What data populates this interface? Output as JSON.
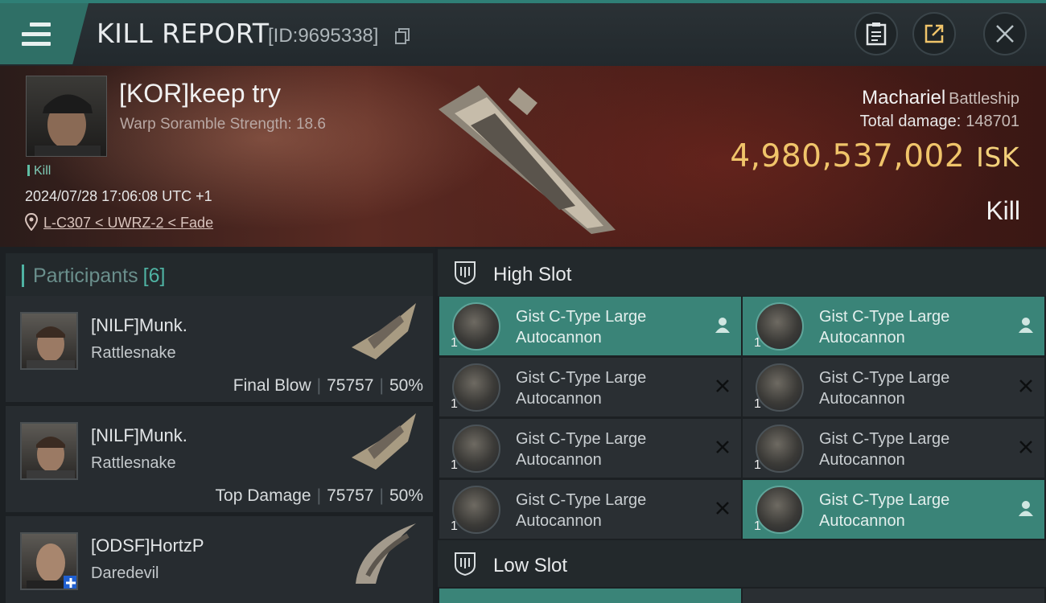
{
  "window": {
    "title": "KILL REPORT",
    "report_id": "[ID:9695338]"
  },
  "victim": {
    "name": "[KOR]keep try",
    "scramble": "Warp Soramble Strength: 18.6",
    "tag": "Kill",
    "datetime": "2024/07/28 17:06:08 UTC +1",
    "location": "L-C307 < UWRZ-2 < Fade",
    "ship_name": "Machariel",
    "ship_class": "Battleship",
    "total_damage_label": "Total damage:",
    "total_damage": "148701",
    "isk_value": "4,980,537,002",
    "isk_unit": "ISK",
    "kill_type": "Kill"
  },
  "participants": {
    "label": "Participants",
    "count": "[6]",
    "rows": [
      {
        "name": "[NILF]Munk.",
        "ship": "Rattlesnake",
        "role": "Final Blow",
        "damage": "75757",
        "percent": "50%"
      },
      {
        "name": "[NILF]Munk.",
        "ship": "Rattlesnake",
        "role": "Top Damage",
        "damage": "75757",
        "percent": "50%"
      },
      {
        "name": "[ODSF]HortzP",
        "ship": "Daredevil"
      }
    ]
  },
  "slots": {
    "high_label": "High Slot",
    "low_label": "Low Slot",
    "modules": [
      {
        "line1": "Gist C-Type Large",
        "line2": "Autocannon",
        "qty": "1",
        "status": "pilot-icon"
      },
      {
        "line1": "Gist C-Type Large",
        "line2": "Autocannon",
        "qty": "1",
        "status": "pilot-icon"
      },
      {
        "line1": "Gist C-Type Large",
        "line2": "Autocannon",
        "qty": "1",
        "status": "destroyed-icon"
      },
      {
        "line1": "Gist C-Type Large",
        "line2": "Autocannon",
        "qty": "1",
        "status": "destroyed-icon"
      },
      {
        "line1": "Gist C-Type Large",
        "line2": "Autocannon",
        "qty": "1",
        "status": "destroyed-icon"
      },
      {
        "line1": "Gist C-Type Large",
        "line2": "Autocannon",
        "qty": "1",
        "status": "destroyed-icon"
      },
      {
        "line1": "Gist C-Type Large",
        "line2": "Autocannon",
        "qty": "1",
        "status": "destroyed-icon"
      },
      {
        "line1": "Gist C-Type Large",
        "line2": "Autocannon",
        "qty": "1",
        "status": "pilot-icon"
      }
    ]
  },
  "colors": {
    "accent": "#3a8478",
    "isk_gold": "#f0c46a",
    "teal_bar": "#2f7f76"
  }
}
